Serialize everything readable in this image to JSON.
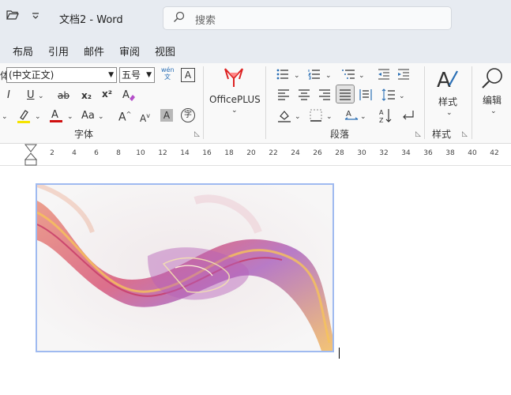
{
  "titlebar": {
    "open_icon": "folder-open-icon",
    "customize_icon": "chevron-down-icon",
    "document_title": "文档2 - Word",
    "search_placeholder": "搜索"
  },
  "tabs": [
    "布局",
    "引用",
    "邮件",
    "审阅",
    "视图"
  ],
  "font_group": {
    "font_name": "(中文正文)",
    "font_size": "五号",
    "phonetic_top": "wén",
    "phonetic_bottom": "文",
    "char_border": "A",
    "italic": "I",
    "underline": "U",
    "strike": "ab",
    "subscript": "x₂",
    "superscript": "x²",
    "grow": "A",
    "shrink": "A",
    "change_case": "Aa",
    "shading": "A",
    "enclose": "字",
    "label": "字体"
  },
  "officeplus": {
    "label": "OfficePLUS"
  },
  "paragraph_group": {
    "label": "段落"
  },
  "styles_group": {
    "button": "样式",
    "label": "样式"
  },
  "editing_group": {
    "button": "编辑"
  },
  "ruler_ticks": [
    "2",
    "4",
    "6",
    "8",
    "10",
    "12",
    "14",
    "16",
    "18",
    "20",
    "22",
    "24",
    "26",
    "28",
    "30",
    "32",
    "34",
    "36",
    "38",
    "40",
    "42"
  ],
  "accent": "#9fbaf0"
}
